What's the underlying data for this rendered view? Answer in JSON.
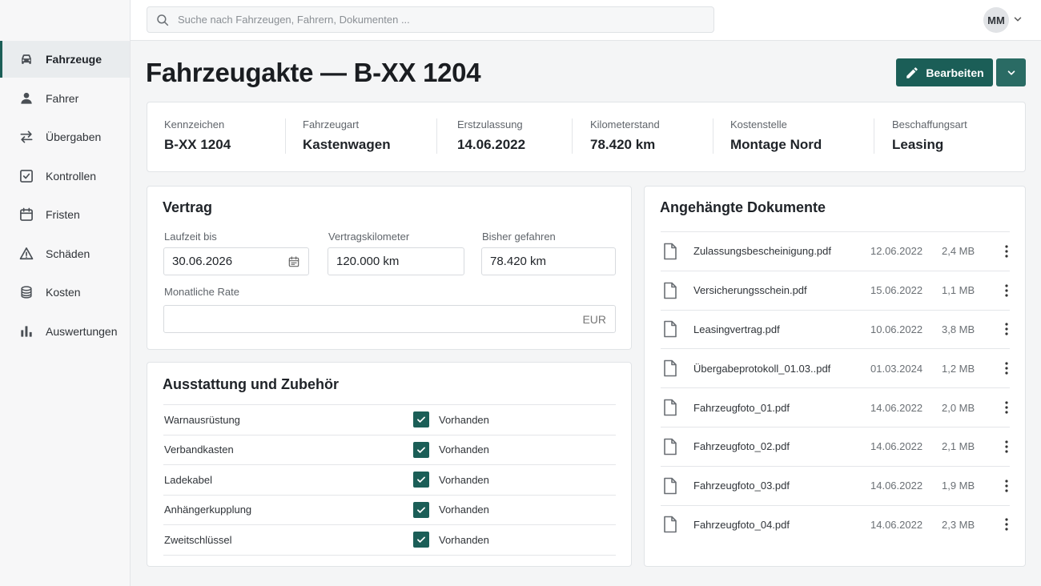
{
  "sidebar": {
    "items": [
      {
        "label": "Fahrzeuge",
        "icon": "car-icon",
        "active": true
      },
      {
        "label": "Fahrer",
        "icon": "person-icon",
        "active": false
      },
      {
        "label": "Übergaben",
        "icon": "swap-arrows-icon",
        "active": false
      },
      {
        "label": "Kontrollen",
        "icon": "checkbox-icon",
        "active": false
      },
      {
        "label": "Fristen",
        "icon": "calendar-icon",
        "active": false
      },
      {
        "label": "Schäden",
        "icon": "warning-icon",
        "active": false
      },
      {
        "label": "Kosten",
        "icon": "coins-icon",
        "active": false
      },
      {
        "label": "Auswertungen",
        "icon": "bar-chart-icon",
        "active": false
      }
    ]
  },
  "topbar": {
    "search_placeholder": "Suche nach Fahrzeugen, Fahrern, Dokumenten ...",
    "avatar_initials": "MM"
  },
  "page": {
    "title": "Fahrzeugakte — B-XX 1204",
    "edit_label": "Bearbeiten"
  },
  "summary": [
    {
      "label": "Kennzeichen",
      "value": "B-XX 1204"
    },
    {
      "label": "Fahrzeugart",
      "value": "Kastenwagen"
    },
    {
      "label": "Erstzulassung",
      "value": "14.06.2022"
    },
    {
      "label": "Kilometerstand",
      "value": "78.420 km"
    },
    {
      "label": "Kostenstelle",
      "value": "Montage Nord"
    },
    {
      "label": "Beschaffungsart",
      "value": "Leasing"
    }
  ],
  "contract": {
    "title": "Vertrag",
    "term_label": "Laufzeit bis",
    "term_value": "30.06.2026",
    "km_label": "Vertragskilometer",
    "km_value": "120.000 km",
    "driven_label": "Bisher gefahren",
    "driven_value": "78.420 km",
    "rate_label": "Monatliche Rate",
    "rate_value": "",
    "rate_suffix": "EUR"
  },
  "equipment": {
    "title": "Ausstattung und Zubehör",
    "rows": [
      {
        "name": "Warnausrüstung",
        "status": "Vorhanden",
        "checked": true
      },
      {
        "name": "Verbandkasten",
        "status": "Vorhanden",
        "checked": true
      },
      {
        "name": "Ladekabel",
        "status": "Vorhanden",
        "checked": true
      },
      {
        "name": "Anhängerkupplung",
        "status": "Vorhanden",
        "checked": true
      },
      {
        "name": "Zweitschlüssel",
        "status": "Vorhanden",
        "checked": true
      }
    ]
  },
  "documents": {
    "title": "Angehängte Dokumente",
    "rows": [
      {
        "name": "Zulassungsbescheinigung.pdf",
        "date": "12.06.2022",
        "size": "2,4 MB"
      },
      {
        "name": "Versicherungsschein.pdf",
        "date": "15.06.2022",
        "size": "1,1 MB"
      },
      {
        "name": "Leasingvertrag.pdf",
        "date": "10.06.2022",
        "size": "3,8 MB"
      },
      {
        "name": "Übergabeprotokoll_01.03..pdf",
        "date": "01.03.2024",
        "size": "1,2 MB"
      },
      {
        "name": "Fahrzeugfoto_01.pdf",
        "date": "14.06.2022",
        "size": "2,0 MB"
      },
      {
        "name": "Fahrzeugfoto_02.pdf",
        "date": "14.06.2022",
        "size": "2,1 MB"
      },
      {
        "name": "Fahrzeugfoto_03.pdf",
        "date": "14.06.2022",
        "size": "1,9 MB"
      },
      {
        "name": "Fahrzeugfoto_04.pdf",
        "date": "14.06.2022",
        "size": "2,3 MB"
      }
    ]
  },
  "colors": {
    "accent": "#1b5e57",
    "sidebar_bg": "#f7f7f8",
    "page_bg": "#f4f5f6"
  }
}
